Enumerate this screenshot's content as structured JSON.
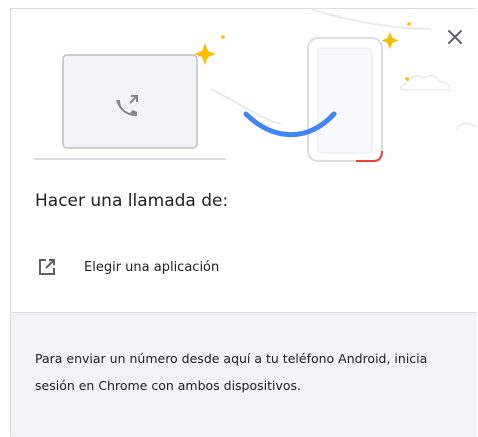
{
  "dialog": {
    "title": "Hacer una llamada de:",
    "choose_app_label": "Elegir una aplicación",
    "footer_text": "Para enviar un número desde aquí a tu teléfono Android, inicia sesión en Chrome con ambos dispositivos.",
    "close_icon": "close-icon",
    "open_external_icon": "open-in-new-icon"
  },
  "colors": {
    "accent_blue": "#4285f4",
    "accent_red": "#ea4335",
    "sparkle_yellow": "#fbbc04",
    "device_gray": "#f1f3f4",
    "outline_gray": "#dadce0"
  }
}
